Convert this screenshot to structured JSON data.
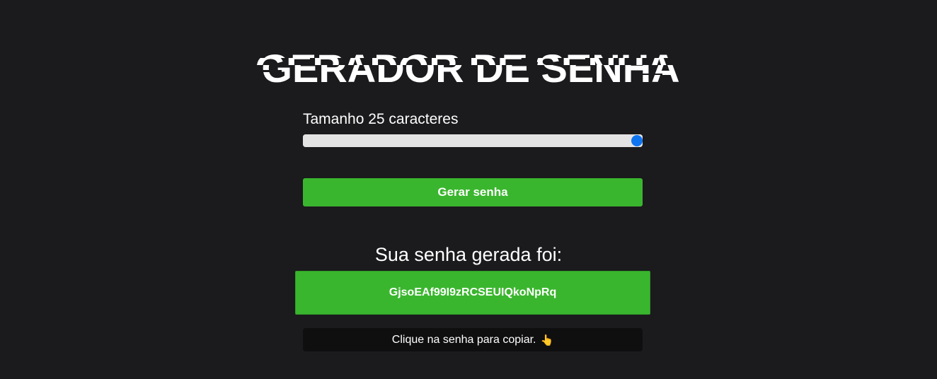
{
  "app": {
    "title": "GERADOR DE SENHA"
  },
  "length": {
    "label": "Tamanho 25 caracteres",
    "value": 25,
    "slider_fraction": 1.0
  },
  "generate_button": {
    "label": "Gerar senha"
  },
  "result": {
    "title": "Sua senha gerada foi:",
    "password": "GjsoEAf99I9zRCSEUIQkoNpRq"
  },
  "hint": {
    "text": "Clique na senha para copiar.",
    "icon": "pointing-hand-icon",
    "glyph": "👆"
  },
  "colors": {
    "background": "#1b1a1d",
    "accent_green": "#3ab62e",
    "slider_track": "#e3e3e3",
    "slider_thumb": "#0f74f0",
    "hint_background": "#0f0f10"
  }
}
